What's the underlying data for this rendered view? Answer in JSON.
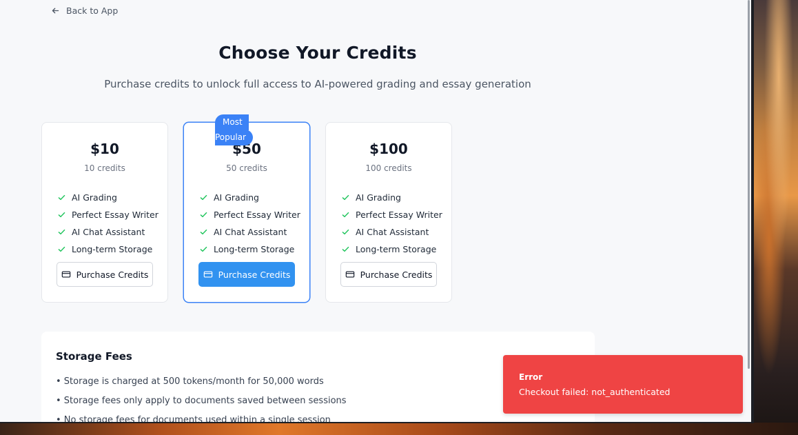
{
  "nav": {
    "back_label": "Back to App"
  },
  "header": {
    "title": "Choose Your Credits",
    "subtitle": "Purchase credits to unlock full access to AI-powered grading and essay generation"
  },
  "plans": [
    {
      "price": "$10",
      "credits": "10 credits",
      "button": "Purchase Credits",
      "featured": false
    },
    {
      "price": "$50",
      "credits": "50 credits",
      "button": "Purchase Credits",
      "featured": true,
      "badge_line1": "Most",
      "badge_line2": "Popular"
    },
    {
      "price": "$100",
      "credits": "100 credits",
      "button": "Purchase Credits",
      "featured": false
    }
  ],
  "features": [
    "AI Grading",
    "Perfect Essay Writer",
    "AI Chat Assistant",
    "Long-term Storage"
  ],
  "storage": {
    "title": "Storage Fees",
    "items": [
      "• Storage is charged at 500 tokens/month for 50,000 words",
      "• Storage fees only apply to documents saved between sessions",
      "• No storage fees for documents used within a single session"
    ]
  },
  "toast": {
    "title": "Error",
    "message": "Checkout failed: not_authenticated"
  },
  "colors": {
    "accent": "#3192f0",
    "badge": "#3b82f6",
    "error": "#ef4444",
    "check": "#22c55e"
  }
}
